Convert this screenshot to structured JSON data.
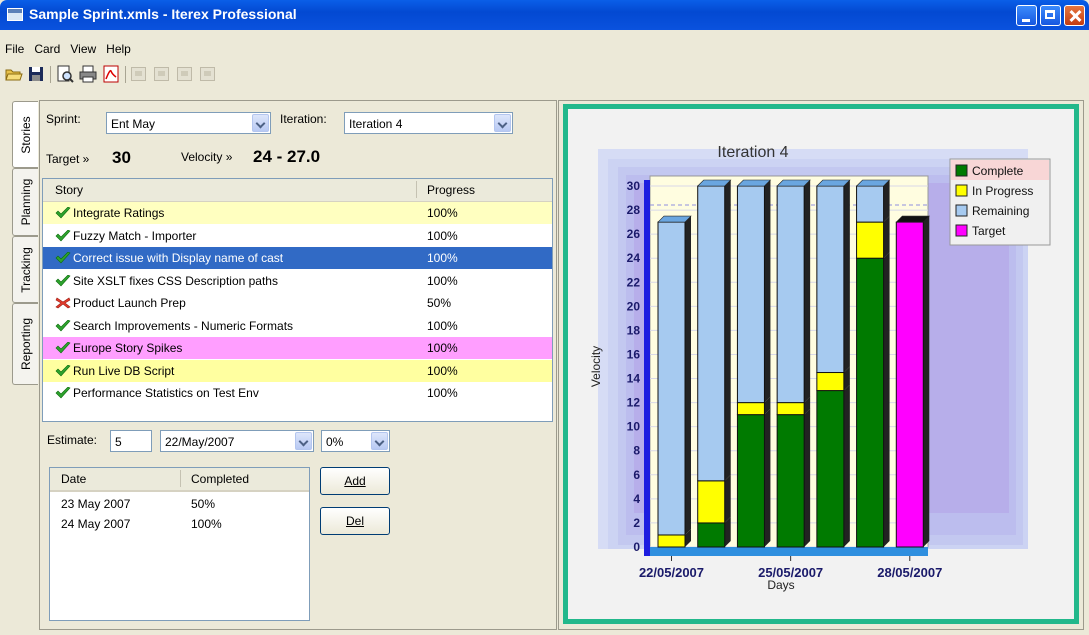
{
  "window": {
    "title": "Sample Sprint.xmls - Iterex Professional"
  },
  "menu": [
    "File",
    "Card",
    "View",
    "Help"
  ],
  "tabs": [
    "Stories",
    "Planning",
    "Tracking",
    "Reporting"
  ],
  "sprint": {
    "label": "Sprint:",
    "value": "Ent May"
  },
  "iteration": {
    "label": "Iteration:",
    "value": "Iteration 4"
  },
  "target": {
    "label": "Target »",
    "value": "30"
  },
  "velocity": {
    "label": "Velocity »",
    "value": "24 - 27.0"
  },
  "story_table": {
    "columns": [
      "Story",
      "Progress"
    ],
    "rows": [
      {
        "story": "Integrate Ratings",
        "progress": "100%",
        "status": "done",
        "highlight": "#ffffc0"
      },
      {
        "story": "Fuzzy Match - Importer",
        "progress": "100%",
        "status": "done",
        "highlight": ""
      },
      {
        "story": "Correct issue with Display name of cast",
        "progress": "100%",
        "status": "done",
        "highlight": "#316ac5",
        "selected": true
      },
      {
        "story": "Site XSLT fixes CSS Description paths",
        "progress": "100%",
        "status": "done",
        "highlight": ""
      },
      {
        "story": "Product Launch Prep",
        "progress": "50%",
        "status": "incomplete",
        "highlight": ""
      },
      {
        "story": "Search Improvements - Numeric Formats",
        "progress": "100%",
        "status": "done",
        "highlight": ""
      },
      {
        "story": "Europe Story Spikes",
        "progress": "100%",
        "status": "done",
        "highlight": "#ff9eff"
      },
      {
        "story": "Run Live DB Script",
        "progress": "100%",
        "status": "done",
        "highlight": "#ffffa0"
      },
      {
        "story": "Performance Statistics on Test Env",
        "progress": "100%",
        "status": "done",
        "highlight": ""
      }
    ]
  },
  "estimate": {
    "label": "Estimate:",
    "value": "5",
    "date": "22/May/2007",
    "percent": "0%"
  },
  "history_table": {
    "columns": [
      "Date",
      "Completed"
    ],
    "rows": [
      {
        "date": "23 May 2007",
        "completed": "50%"
      },
      {
        "date": "24 May 2007",
        "completed": "100%"
      }
    ]
  },
  "buttons": {
    "add": "Add",
    "del": "Del"
  },
  "colors": {
    "complete": "#007a00",
    "in_progress": "#ffff00",
    "remaining": "#a6caf0",
    "target": "#ff00ff",
    "frame": "#22b88b"
  },
  "chart_data": {
    "type": "bar",
    "stacked": true,
    "title": "Iteration 4",
    "xlabel": "Days",
    "ylabel": "Velocity",
    "ylim": [
      0,
      30
    ],
    "yticks": [
      0,
      2,
      4,
      6,
      8,
      10,
      12,
      14,
      16,
      18,
      20,
      22,
      24,
      26,
      28,
      30
    ],
    "x_tick_labels": [
      "22/05/2007",
      "25/05/2007",
      "28/05/2007"
    ],
    "legend_position": "top-right",
    "series": [
      {
        "name": "Complete",
        "values": [
          0,
          2,
          11,
          11,
          13,
          24,
          0
        ]
      },
      {
        "name": "In Progress",
        "values": [
          1,
          3.5,
          1,
          1,
          1.5,
          3,
          0
        ]
      },
      {
        "name": "Remaining",
        "values": [
          26,
          24.5,
          18,
          18,
          15.5,
          3,
          0
        ]
      },
      {
        "name": "Target",
        "values": [
          0,
          0,
          0,
          0,
          0,
          0,
          27
        ]
      }
    ]
  }
}
